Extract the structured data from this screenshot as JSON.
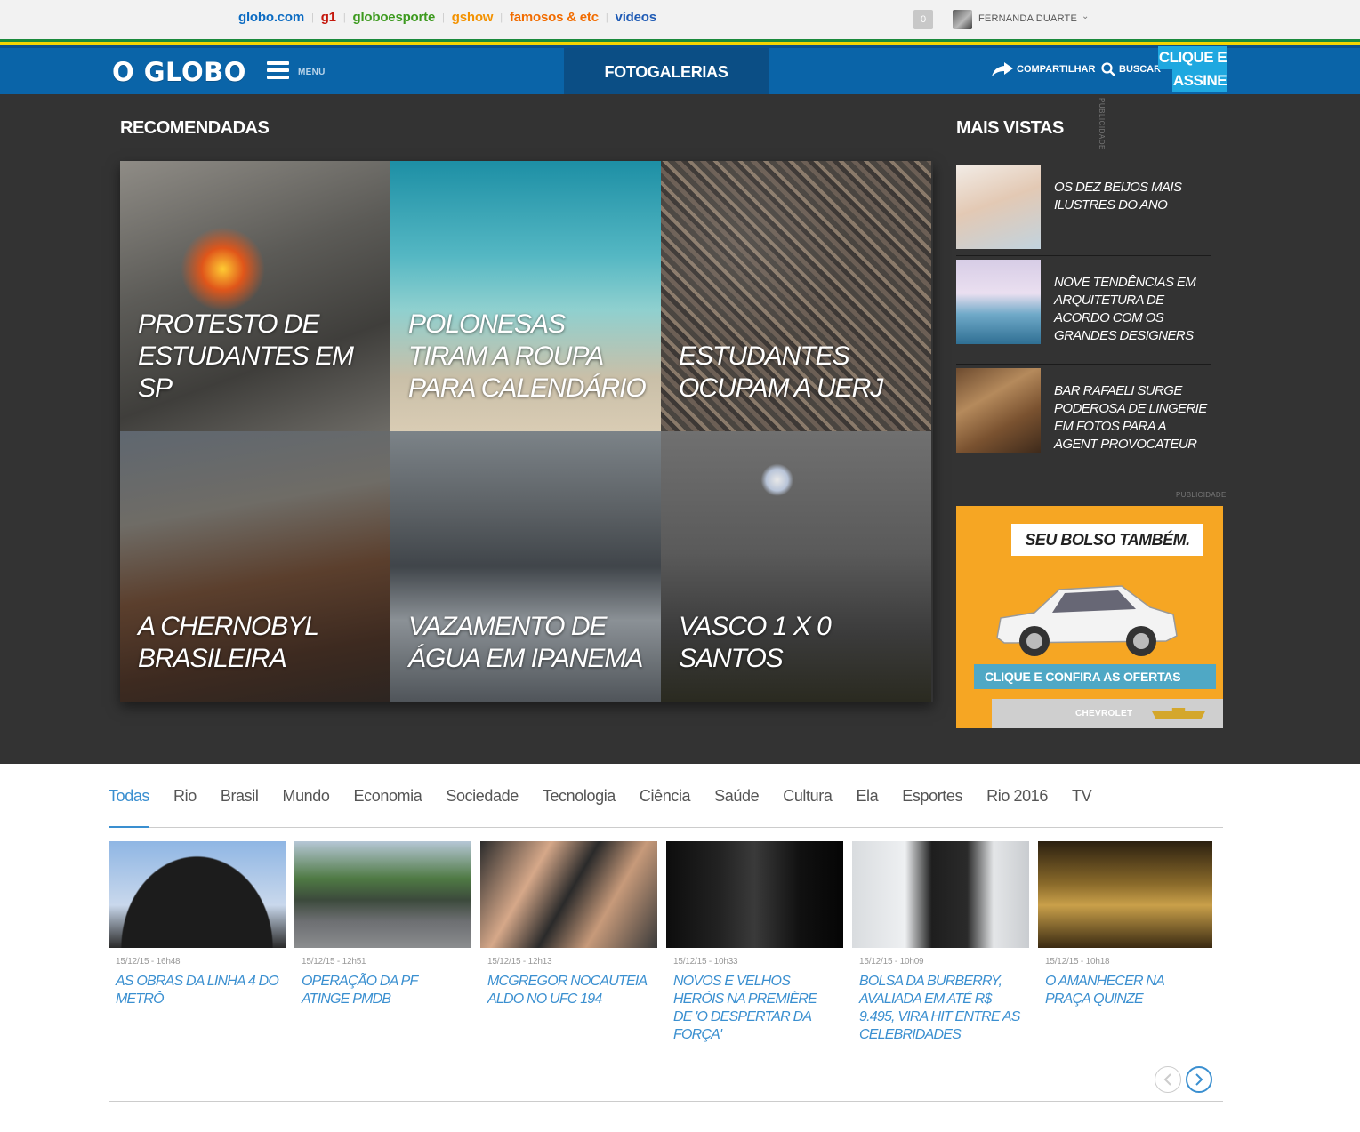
{
  "topbar": {
    "links": [
      {
        "label": "globo.com",
        "color": "#0b6bc2"
      },
      {
        "label": "g1",
        "color": "#c4170c"
      },
      {
        "label": "globoesporte",
        "color": "#3d9a1f"
      },
      {
        "label": "gshow",
        "color": "#f39200"
      },
      {
        "label": "famosos & etc",
        "color": "#f26c00"
      },
      {
        "label": "vídeos",
        "color": "#1f5bb5"
      }
    ],
    "notification_count": "0",
    "user_name": "FERNANDA DUARTE"
  },
  "navbar": {
    "logo": "O GLOBO",
    "menu_label": "MENU",
    "section": "FOTOGALERIAS",
    "share_label": "COMPARTILHAR",
    "search_label": "BUSCAR",
    "subscribe_line1": "CLIQUE E",
    "subscribe_line2": "ASSINE"
  },
  "recomendadas": {
    "heading": "RECOMENDADAS",
    "items": [
      "PROTESTO DE ESTUDANTES EM SP",
      "POLONESAS TIRAM A ROUPA PARA CALENDÁRIO",
      "ESTUDANTES OCUPAM A UERJ",
      "A CHERNOBYL BRASILEIRA",
      "VAZAMENTO DE ÁGUA EM IPANEMA",
      "VASCO 1 X 0 SANTOS"
    ]
  },
  "mais_vistas": {
    "heading": "MAIS VISTAS",
    "publicidade_vertical": "PUBLICIDADE",
    "items": [
      "OS DEZ BEIJOS MAIS ILUSTRES DO ANO",
      "NOVE TENDÊNCIAS EM ARQUITETURA DE ACORDO COM OS GRANDES DESIGNERS",
      "BAR RAFAELI SURGE PODEROSA DE LINGERIE EM FOTOS PARA A AGENT PROVOCATEUR"
    ]
  },
  "ad": {
    "label": "PUBLICIDADE",
    "headline": "SEU BOLSO TAMBÉM.",
    "cta": "CLIQUE E CONFIRA AS OFERTAS",
    "brand": "CHEVROLET"
  },
  "tabs": {
    "active": "Todas",
    "items": [
      "Todas",
      "Rio",
      "Brasil",
      "Mundo",
      "Economia",
      "Sociedade",
      "Tecnologia",
      "Ciência",
      "Saúde",
      "Cultura",
      "Ela",
      "Esportes",
      "Rio 2016",
      "TV"
    ]
  },
  "cards": [
    {
      "date": "15/12/15 - 16h48",
      "title": "AS OBRAS DA LINHA 4 DO METRÔ"
    },
    {
      "date": "15/12/15 - 12h51",
      "title": "OPERAÇÃO DA PF ATINGE PMDB"
    },
    {
      "date": "15/12/15 - 12h13",
      "title": "MCGREGOR NOCAUTEIA ALDO NO UFC 194"
    },
    {
      "date": "15/12/15 - 10h33",
      "title": "NOVOS E VELHOS HERÓIS NA PREMIÈRE DE 'O DESPERTAR DA FORÇA'"
    },
    {
      "date": "15/12/15 - 10h09",
      "title": "BOLSA DA BURBERRY, AVALIADA EM ATÉ R$ 9.495, VIRA HIT ENTRE AS CELEBRIDADES"
    },
    {
      "date": "15/12/15 - 10h18",
      "title": "O AMANHECER NA PRAÇA QUINZE"
    }
  ]
}
